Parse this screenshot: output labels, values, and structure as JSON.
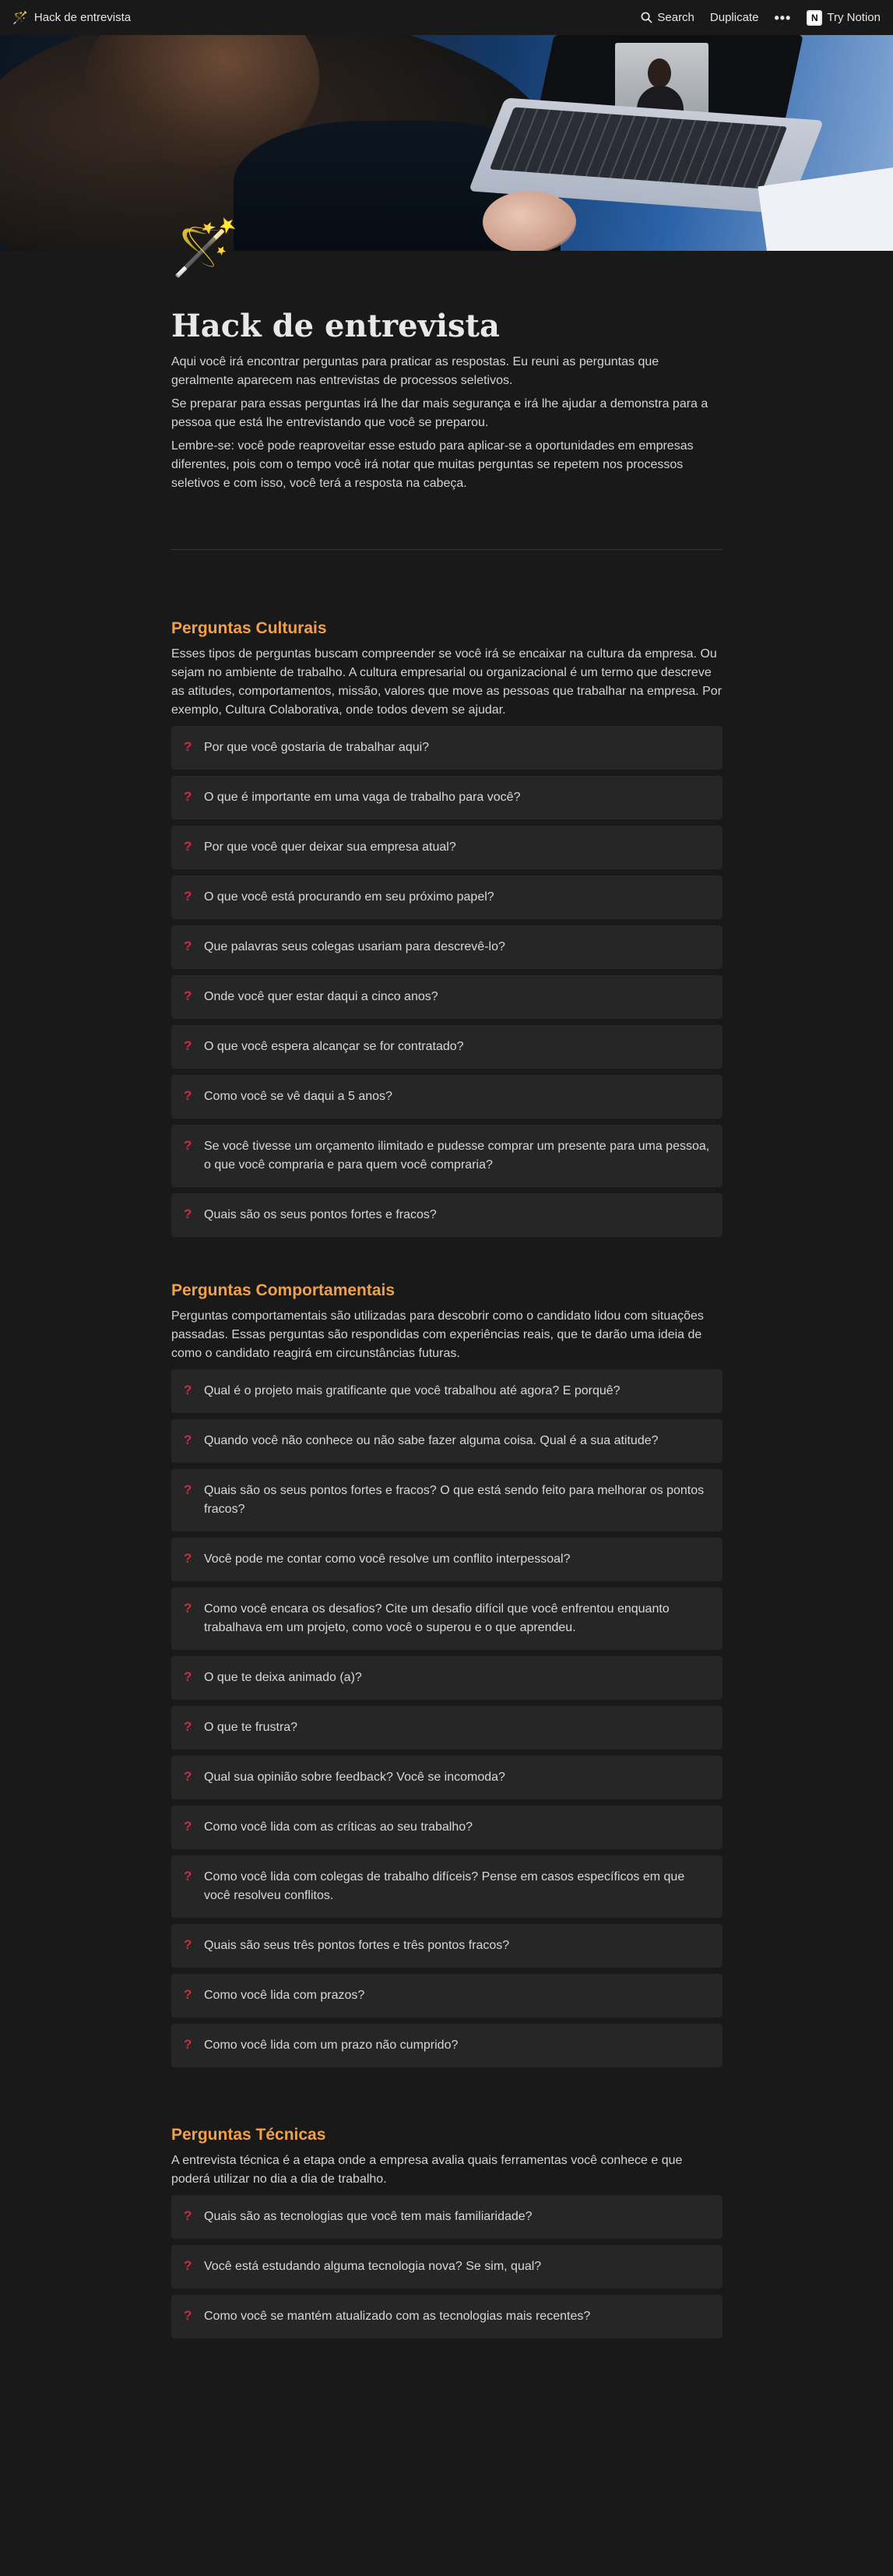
{
  "topbar": {
    "page_title": "Hack de entrevista",
    "search_label": "Search",
    "duplicate_label": "Duplicate",
    "more_label": "•••",
    "try_notion_label": "Try Notion"
  },
  "page": {
    "icon": "magic-wand-icon",
    "title": "Hack de entrevista",
    "intro": [
      "Aqui você irá encontrar perguntas para praticar as respostas. Eu reuni as perguntas que geralmente aparecem nas entrevistas de processos seletivos.",
      "Se preparar para essas perguntas irá lhe dar mais segurança e irá lhe ajudar a demonstra para a pessoa que está lhe entrevistando que você se preparou.",
      "Lembre-se: você pode reaproveitar esse estudo para aplicar-se a oportunidades em empresas diferentes, pois com o tempo você irá notar que muitas perguntas se repetem nos processos seletivos e com isso, você terá a resposta na cabeça."
    ]
  },
  "sections": [
    {
      "title": "Perguntas Culturais",
      "description": "Esses tipos de perguntas buscam compreender se você irá se encaixar na cultura da empresa. Ou sejam no ambiente de trabalho. A cultura empresarial ou organizacional é um termo que descreve as atitudes, comportamentos, missão, valores que move as pessoas que trabalhar na empresa. Por exemplo, Cultura Colaborativa, onde todos devem se ajudar.",
      "questions": [
        "Por que você gostaria de trabalhar aqui?",
        "O que é importante em uma vaga de trabalho para você?",
        "Por que você quer deixar sua empresa atual?",
        "O que você está procurando em seu próximo papel?",
        "Que palavras seus colegas usariam para descrevê-lo?",
        "Onde você quer estar daqui a cinco anos?",
        "O que você espera alcançar se for contratado?",
        "Como você se vê daqui a 5 anos?",
        "Se você tivesse um orçamento ilimitado e pudesse comprar um presente para uma pessoa, o que você compraria e para quem você compraria?",
        "Quais são os seus pontos fortes e fracos?"
      ]
    },
    {
      "title": "Perguntas Comportamentais",
      "description": "Perguntas comportamentais são utilizadas para descobrir como o candidato lidou com situações passadas. Essas perguntas são respondidas com experiências reais, que te darão uma ideia de como o candidato reagirá em circunstâncias futuras.",
      "questions": [
        "Qual é o projeto mais gratificante que você trabalhou até agora? E porquê?",
        "Quando você não conhece ou não sabe fazer alguma coisa. Qual é a sua atitude?",
        "Quais são os seus pontos fortes e fracos? O que está sendo feito para melhorar os pontos fracos?",
        "Você pode me contar como você resolve um conflito interpessoal?",
        "Como você encara os desafios? Cite um desafio difícil que você enfrentou enquanto trabalhava em um projeto, como você o superou e o que aprendeu.",
        "O que te deixa animado (a)?",
        "O que te frustra?",
        "Qual sua opinião sobre feedback? Você se incomoda?",
        "Como você lida com as críticas ao seu trabalho?",
        "Como você lida com colegas de trabalho difíceis? Pense em casos específicos em que você resolveu conflitos.",
        "Quais são seus três pontos fortes e três pontos fracos?",
        "Como você lida com prazos?",
        "Como você lida com um prazo não cumprido?"
      ]
    },
    {
      "title": "Perguntas Técnicas",
      "description": "A entrevista técnica é a etapa onde a empresa avalia quais ferramentas você conhece e que poderá utilizar no dia a dia de trabalho.",
      "questions": [
        "Quais são as tecnologias que você tem mais familiaridade?",
        "Você está estudando alguma tecnologia nova? Se sim, qual?",
        "Como você se mantém atualizado com as tecnologias mais recentes?"
      ]
    }
  ],
  "colors": {
    "background": "#191919",
    "section_title": "#f0a04b",
    "callout_bg": "#262626",
    "question_mark": "#d7263d"
  },
  "question_icon": "red-question-mark-icon"
}
